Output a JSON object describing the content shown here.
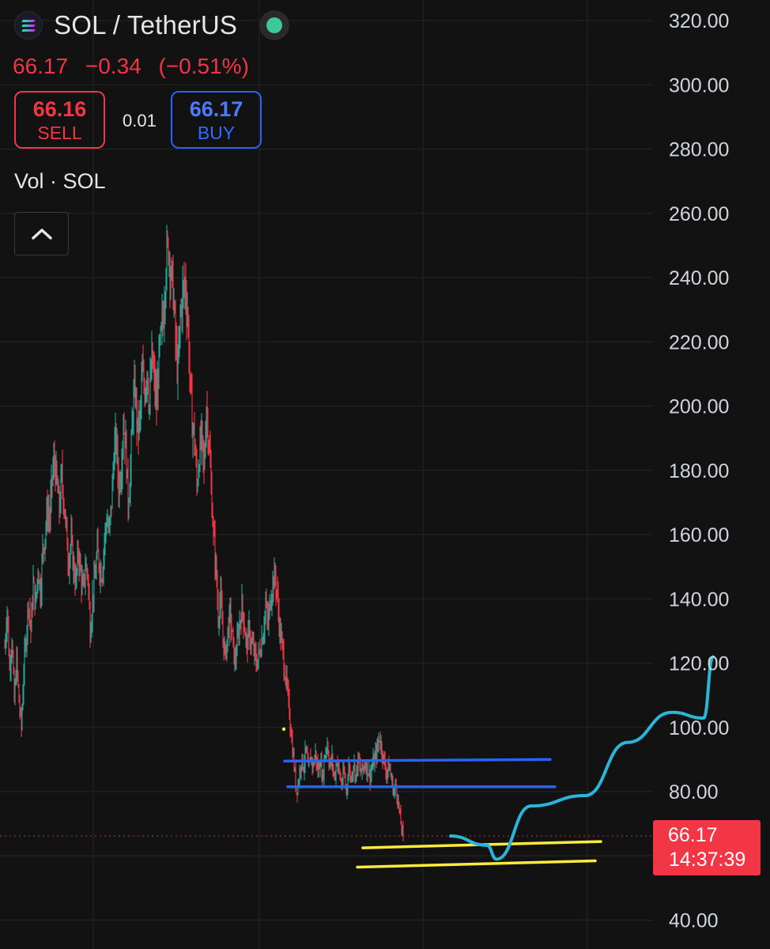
{
  "header": {
    "symbol": "SOL / TetherUS",
    "last_price": "66.17",
    "change": "−0.34",
    "change_pct": "(−0.51%)",
    "status_color": "#3ec99b"
  },
  "trade": {
    "sell_price": "66.16",
    "sell_label": "SELL",
    "spread": "0.01",
    "buy_price": "66.17",
    "buy_label": "BUY"
  },
  "indicators": {
    "volume_label": "Vol · SOL",
    "collapse_icon": "chevron-up-icon"
  },
  "price_tag": {
    "price": "66.17",
    "countdown": "14:37:39",
    "color": "#f23645"
  },
  "colors": {
    "up": "#26a69a",
    "down": "#f23645",
    "blue_line": "#2962ff",
    "yellow_line": "#ffeb3b",
    "projection": "#29b6d8"
  },
  "chart_data": {
    "type": "candlestick",
    "y_axis": {
      "ticks": [
        320,
        300,
        280,
        260,
        240,
        220,
        200,
        180,
        160,
        140,
        120,
        100,
        80,
        40
      ],
      "tick_labels": [
        "320.00",
        "300.00",
        "280.00",
        "260.00",
        "240.00",
        "220.00",
        "200.00",
        "180.00",
        "160.00",
        "140.00",
        "120.00",
        "100.00",
        "80.00",
        "40.00"
      ],
      "range": [
        37,
        322
      ],
      "grid": true
    },
    "price_path": [
      [
        0,
        125
      ],
      [
        3,
        137
      ],
      [
        6,
        118
      ],
      [
        9,
        128
      ],
      [
        12,
        108
      ],
      [
        15,
        121
      ],
      [
        18,
        108
      ],
      [
        21,
        100
      ],
      [
        24,
        118
      ],
      [
        27,
        128
      ],
      [
        30,
        140
      ],
      [
        33,
        130
      ],
      [
        36,
        145
      ],
      [
        39,
        138
      ],
      [
        42,
        150
      ],
      [
        45,
        142
      ],
      [
        48,
        155
      ],
      [
        51,
        160
      ],
      [
        54,
        168
      ],
      [
        57,
        165
      ],
      [
        60,
        178
      ],
      [
        63,
        183
      ],
      [
        66,
        175
      ],
      [
        69,
        168
      ],
      [
        72,
        178
      ],
      [
        75,
        170
      ],
      [
        78,
        160
      ],
      [
        81,
        152
      ],
      [
        84,
        158
      ],
      [
        87,
        150
      ],
      [
        90,
        145
      ],
      [
        93,
        155
      ],
      [
        96,
        148
      ],
      [
        99,
        142
      ],
      [
        102,
        150
      ],
      [
        105,
        148
      ],
      [
        108,
        130
      ],
      [
        111,
        140
      ],
      [
        114,
        146
      ],
      [
        117,
        155
      ],
      [
        120,
        150
      ],
      [
        123,
        148
      ],
      [
        126,
        158
      ],
      [
        129,
        165
      ],
      [
        132,
        160
      ],
      [
        135,
        170
      ],
      [
        138,
        185
      ],
      [
        141,
        190
      ],
      [
        144,
        175
      ],
      [
        147,
        180
      ],
      [
        150,
        195
      ],
      [
        153,
        188
      ],
      [
        156,
        170
      ],
      [
        159,
        180
      ],
      [
        162,
        200
      ],
      [
        165,
        205
      ],
      [
        168,
        192
      ],
      [
        171,
        196
      ],
      [
        174,
        210
      ],
      [
        177,
        205
      ],
      [
        180,
        212
      ],
      [
        183,
        200
      ],
      [
        186,
        215
      ],
      [
        189,
        208
      ],
      [
        192,
        200
      ],
      [
        195,
        215
      ],
      [
        198,
        222
      ],
      [
        201,
        230
      ],
      [
        204,
        245
      ],
      [
        207,
        250
      ],
      [
        210,
        242
      ],
      [
        213,
        236
      ],
      [
        216,
        220
      ],
      [
        219,
        210
      ],
      [
        222,
        228
      ],
      [
        225,
        235
      ],
      [
        228,
        238
      ],
      [
        231,
        230
      ],
      [
        234,
        210
      ],
      [
        237,
        195
      ],
      [
        240,
        190
      ],
      [
        243,
        175
      ],
      [
        246,
        185
      ],
      [
        249,
        190
      ],
      [
        252,
        180
      ],
      [
        255,
        200
      ],
      [
        258,
        190
      ],
      [
        261,
        175
      ],
      [
        264,
        160
      ],
      [
        267,
        150
      ],
      [
        270,
        135
      ],
      [
        273,
        140
      ],
      [
        276,
        128
      ],
      [
        279,
        122
      ],
      [
        282,
        130
      ],
      [
        285,
        135
      ],
      [
        288,
        128
      ],
      [
        291,
        120
      ],
      [
        294,
        126
      ],
      [
        297,
        132
      ],
      [
        300,
        138
      ],
      [
        303,
        132
      ],
      [
        306,
        125
      ],
      [
        309,
        130
      ],
      [
        312,
        126
      ],
      [
        315,
        124
      ],
      [
        318,
        120
      ],
      [
        321,
        122
      ],
      [
        324,
        126
      ],
      [
        327,
        130
      ],
      [
        330,
        138
      ],
      [
        333,
        132
      ],
      [
        336,
        140
      ],
      [
        339,
        145
      ],
      [
        342,
        147
      ],
      [
        345,
        140
      ],
      [
        348,
        130
      ],
      [
        351,
        125
      ],
      [
        354,
        118
      ],
      [
        357,
        112
      ],
      [
        360,
        105
      ],
      [
        363,
        96
      ],
      [
        366,
        88
      ],
      [
        369,
        80
      ],
      [
        372,
        84
      ],
      [
        375,
        90
      ],
      [
        378,
        88
      ],
      [
        381,
        93
      ],
      [
        384,
        86
      ],
      [
        387,
        91
      ],
      [
        390,
        88
      ],
      [
        393,
        92
      ],
      [
        396,
        86
      ],
      [
        399,
        90
      ],
      [
        402,
        84
      ],
      [
        405,
        92
      ],
      [
        408,
        95
      ],
      [
        411,
        88
      ],
      [
        414,
        90
      ],
      [
        417,
        84
      ],
      [
        420,
        90
      ],
      [
        423,
        86
      ],
      [
        426,
        82
      ],
      [
        429,
        86
      ],
      [
        432,
        80
      ],
      [
        435,
        88
      ],
      [
        438,
        84
      ],
      [
        441,
        89
      ],
      [
        444,
        85
      ],
      [
        447,
        90
      ],
      [
        450,
        86
      ],
      [
        453,
        87
      ],
      [
        456,
        89
      ],
      [
        459,
        87
      ],
      [
        462,
        85
      ],
      [
        465,
        88
      ],
      [
        468,
        90
      ],
      [
        471,
        93
      ],
      [
        474,
        97
      ],
      [
        477,
        93
      ],
      [
        480,
        89
      ],
      [
        483,
        86
      ],
      [
        486,
        88
      ],
      [
        489,
        84
      ],
      [
        492,
        80
      ],
      [
        495,
        82
      ],
      [
        498,
        76
      ],
      [
        501,
        70
      ],
      [
        504,
        66.17
      ]
    ],
    "price_lines": [
      {
        "name": "blue-upper",
        "value": 89.5,
        "color": "#2962ff"
      },
      {
        "name": "blue-lower",
        "value": 81.5,
        "color": "#2962ff"
      },
      {
        "name": "yellow-upper",
        "value": 62.5,
        "color": "#ffeb3b"
      },
      {
        "name": "yellow-lower",
        "value": 56.5,
        "color": "#ffeb3b"
      },
      {
        "name": "last-price",
        "value": 66.17,
        "color": "#f23645"
      }
    ],
    "projection": [
      [
        66,
        0
      ],
      [
        112,
        -8
      ],
      [
        124,
        -20
      ],
      [
        168,
        26
      ],
      [
        236,
        35
      ],
      [
        290,
        81
      ],
      [
        346,
        107
      ],
      [
        386,
        102
      ],
      [
        398,
        155
      ]
    ]
  }
}
